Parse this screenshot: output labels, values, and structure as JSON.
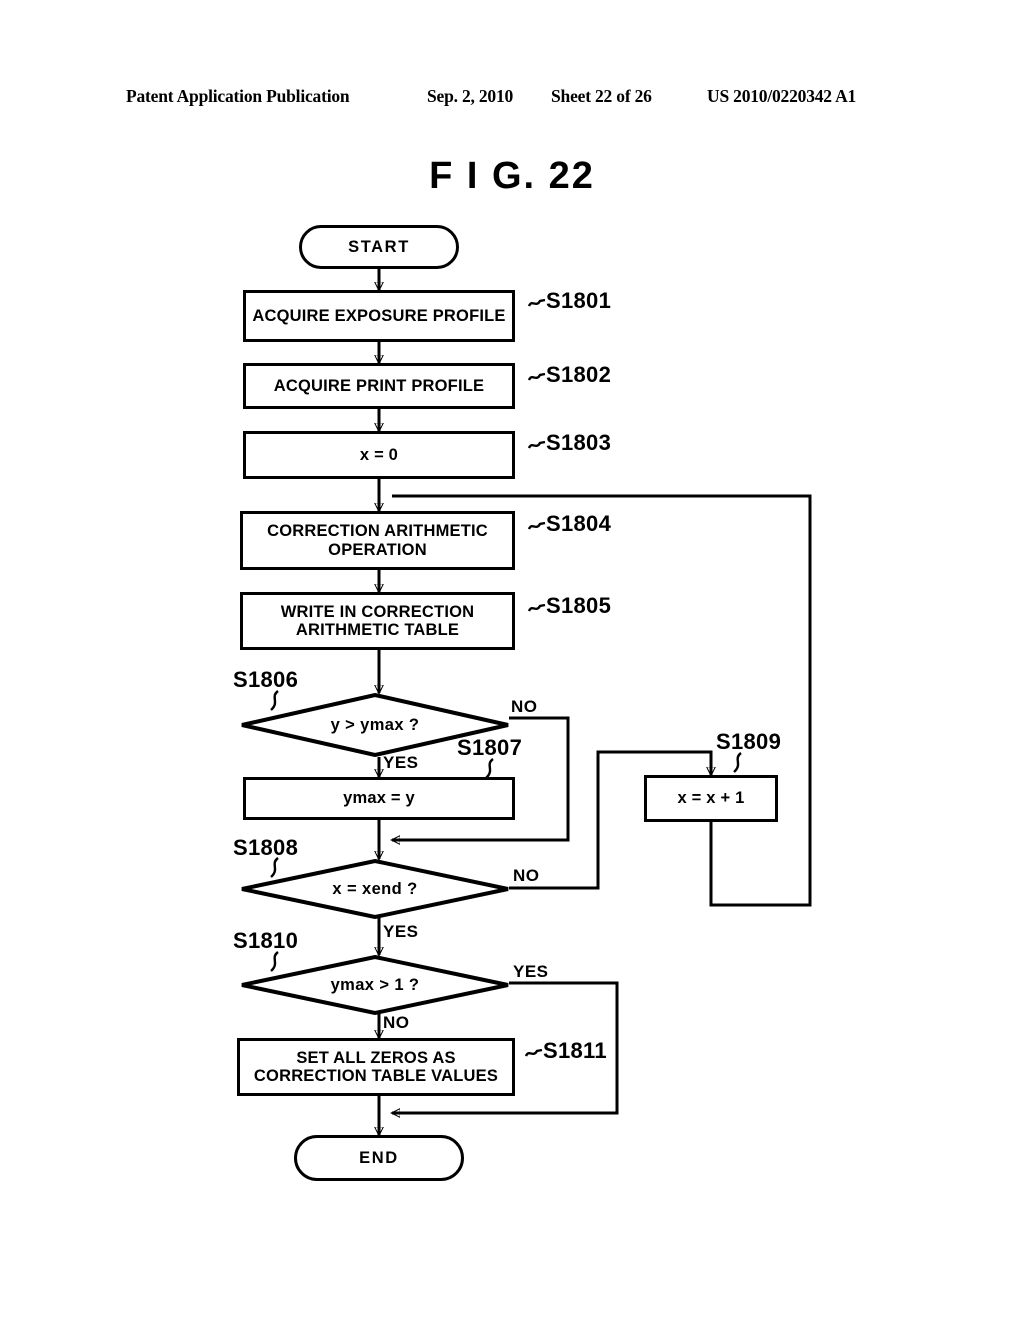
{
  "header": {
    "publication": "Patent Application Publication",
    "date": "Sep. 2, 2010",
    "sheet": "Sheet 22 of 26",
    "document_number": "US 2010/0220342 A1"
  },
  "figure": {
    "title": "F I G.   22"
  },
  "diagram": {
    "type": "flowchart",
    "nodes": [
      {
        "id": "start",
        "shape": "terminator",
        "text": "START"
      },
      {
        "id": "s1801",
        "shape": "process",
        "text": "ACQUIRE EXPOSURE PROFILE",
        "step": "S1801"
      },
      {
        "id": "s1802",
        "shape": "process",
        "text": "ACQUIRE PRINT PROFILE",
        "step": "S1802"
      },
      {
        "id": "s1803",
        "shape": "process",
        "text": "x = 0",
        "step": "S1803"
      },
      {
        "id": "s1804",
        "shape": "process",
        "text": "CORRECTION ARITHMETIC\nOPERATION",
        "step": "S1804"
      },
      {
        "id": "s1805",
        "shape": "process",
        "text": "WRITE IN CORRECTION\nARITHMETIC TABLE",
        "step": "S1805"
      },
      {
        "id": "s1806",
        "shape": "decision",
        "text": "y > ymax ?",
        "step": "S1806"
      },
      {
        "id": "s1807",
        "shape": "process",
        "text": "ymax = y",
        "step": "S1807"
      },
      {
        "id": "s1808",
        "shape": "decision",
        "text": "x = xend ?",
        "step": "S1808"
      },
      {
        "id": "s1809",
        "shape": "process",
        "text": "x = x  + 1",
        "step": "S1809"
      },
      {
        "id": "s1810",
        "shape": "decision",
        "text": "ymax > 1 ?",
        "step": "S1810"
      },
      {
        "id": "s1811",
        "shape": "process",
        "text": "SET ALL ZEROS AS\nCORRECTION TABLE VALUES",
        "step": "S1811"
      },
      {
        "id": "end",
        "shape": "terminator",
        "text": "END"
      }
    ],
    "branch_labels": {
      "s1806_no": "NO",
      "s1806_yes": "YES",
      "s1808_no": "NO",
      "s1808_yes": "YES",
      "s1810_yes": "YES",
      "s1810_no": "NO"
    },
    "edges": [
      {
        "from": "start",
        "to": "s1801"
      },
      {
        "from": "s1801",
        "to": "s1802"
      },
      {
        "from": "s1802",
        "to": "s1803"
      },
      {
        "from": "s1803",
        "to": "s1804"
      },
      {
        "from": "s1804",
        "to": "s1805"
      },
      {
        "from": "s1805",
        "to": "s1806"
      },
      {
        "from": "s1806",
        "to": "s1807",
        "label": "YES"
      },
      {
        "from": "s1806",
        "to": "s1808",
        "label": "NO"
      },
      {
        "from": "s1807",
        "to": "s1808"
      },
      {
        "from": "s1808",
        "to": "s1809",
        "label": "NO"
      },
      {
        "from": "s1808",
        "to": "s1810",
        "label": "YES"
      },
      {
        "from": "s1809",
        "to": "s1804"
      },
      {
        "from": "s1810",
        "to": "s1811",
        "label": "NO"
      },
      {
        "from": "s1810",
        "to": "end",
        "label": "YES"
      },
      {
        "from": "s1811",
        "to": "end"
      }
    ]
  },
  "colors": {
    "ink": "#000000",
    "paper": "#ffffff"
  }
}
